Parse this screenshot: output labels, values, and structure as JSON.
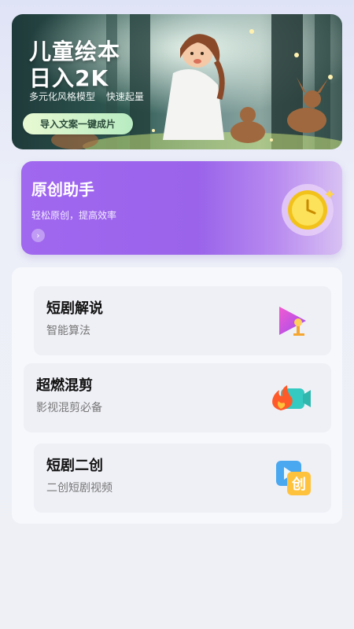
{
  "hero": {
    "title_line1": "儿童绘本",
    "title_line2": "日入2K",
    "subtitle": "多元化风格模型 快速起量",
    "button": "导入文案一键成片"
  },
  "original": {
    "title": "原创助手",
    "subtitle": "轻松原创，提高效率",
    "arrow": "›",
    "icon": "clock-icon"
  },
  "tools": [
    {
      "title": "短剧解说",
      "subtitle": "智能算法",
      "icon": "video-play-icon"
    },
    {
      "title": "超燃混剪",
      "subtitle": "影视混剪必备",
      "icon": "fire-camera-icon"
    },
    {
      "title": "短剧二创",
      "subtitle": "二创短剧视频",
      "icon": "create-icon",
      "icon_text": "创"
    }
  ],
  "colors": {
    "accent_purple": "#9a63ea",
    "hero_button": "#c8f0c8"
  }
}
